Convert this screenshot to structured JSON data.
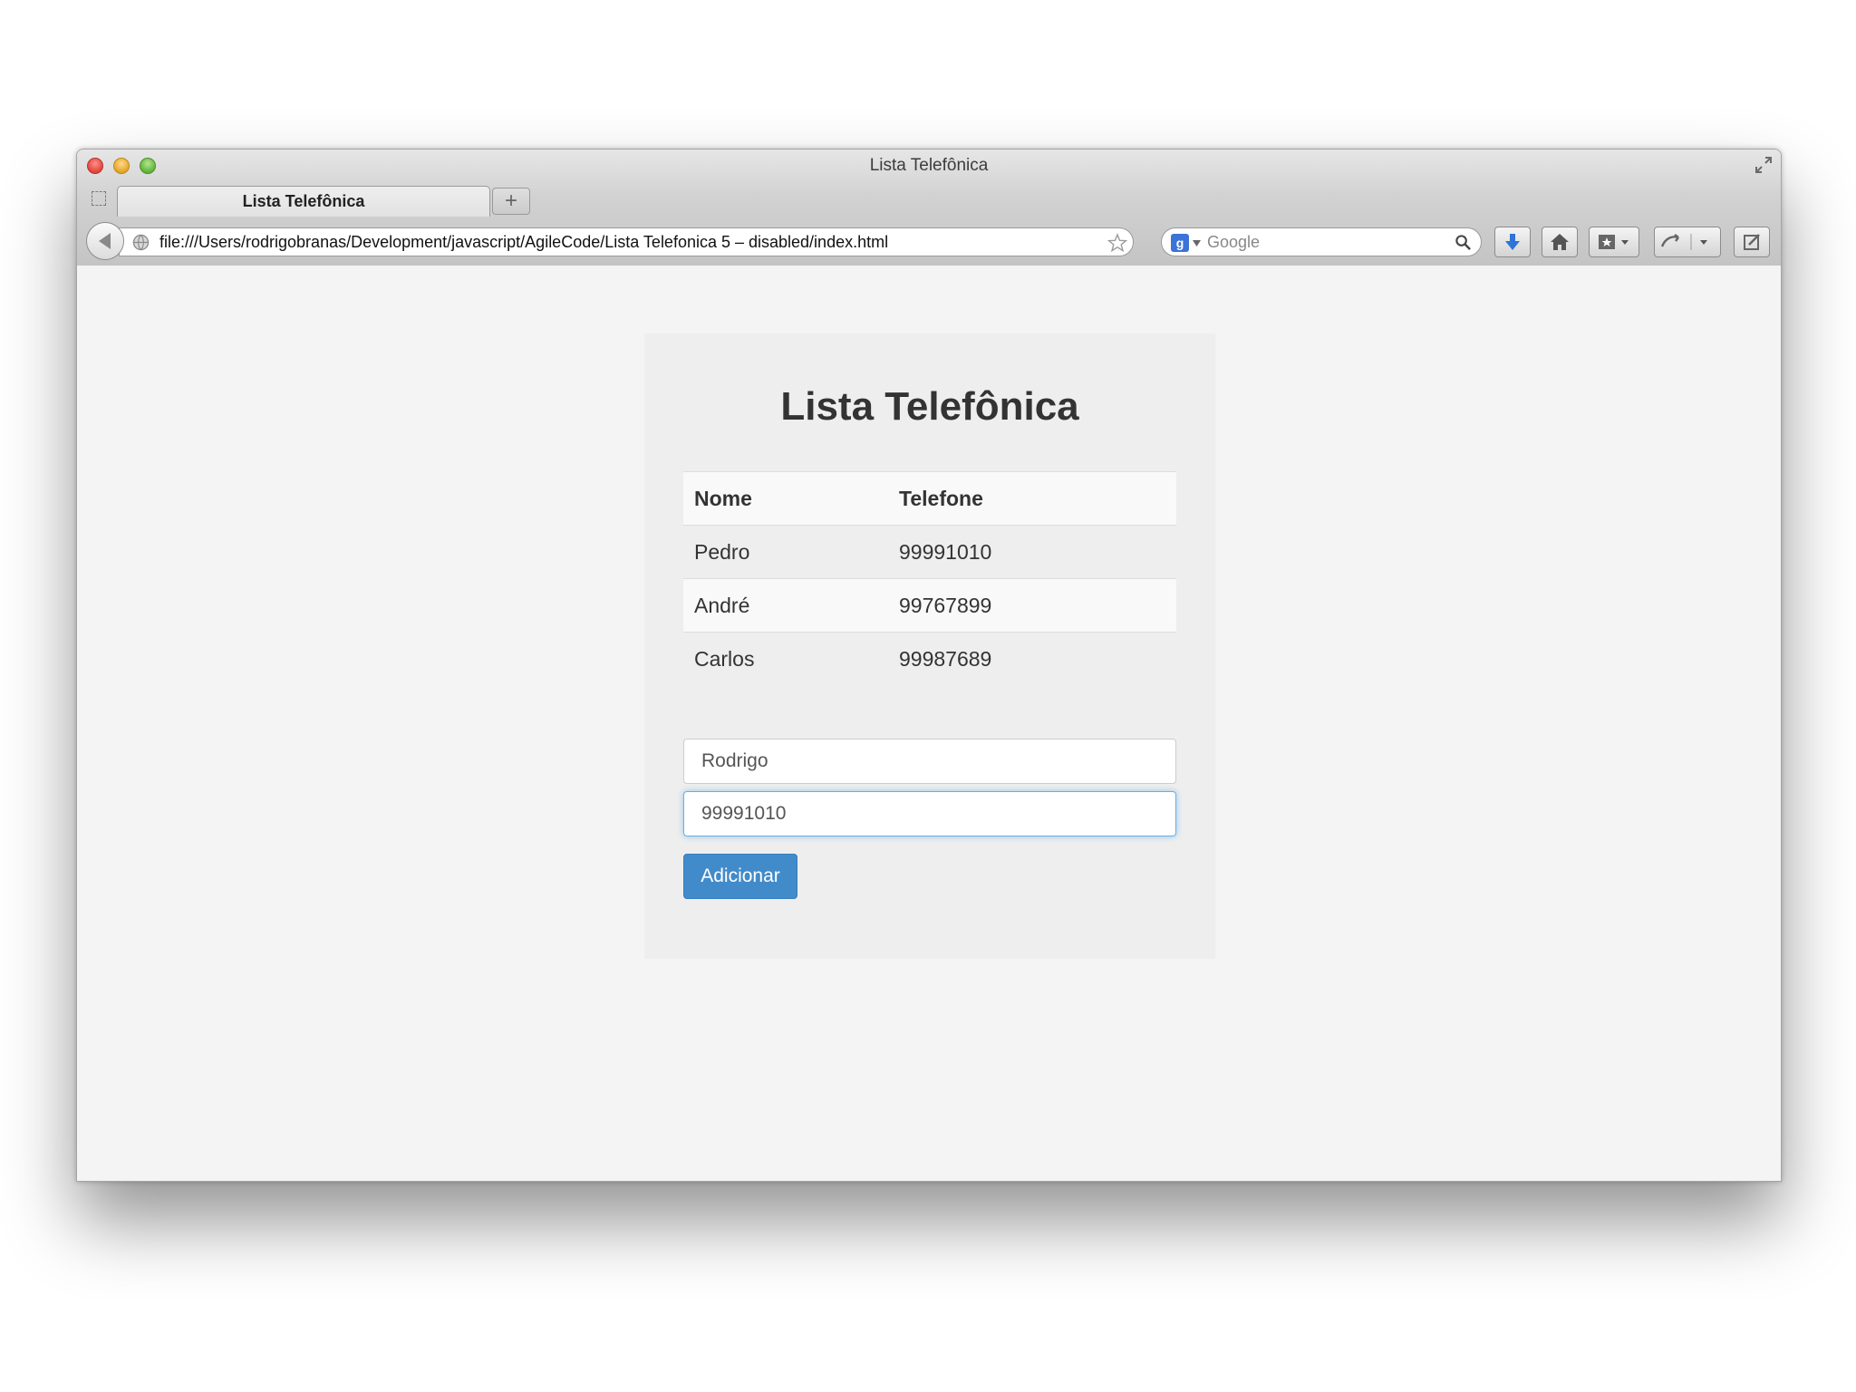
{
  "browser": {
    "window_title": "Lista Telefônica",
    "tab_label": "Lista Telefônica",
    "new_tab_label": "+",
    "url": "file:///Users/rodrigobranas/Development/javascript/AgileCode/Lista Telefonica 5 – disabled/index.html",
    "search_placeholder": "Google",
    "search_engine_letter": "g"
  },
  "page": {
    "title": "Lista Telefônica",
    "table": {
      "headers": [
        "Nome",
        "Telefone"
      ],
      "rows": [
        {
          "nome": "Pedro",
          "telefone": "99991010"
        },
        {
          "nome": "André",
          "telefone": "99767899"
        },
        {
          "nome": "Carlos",
          "telefone": "99987689"
        }
      ]
    },
    "form": {
      "name_value": "Rodrigo",
      "phone_value": "99991010",
      "add_button_label": "Adicionar"
    }
  },
  "colors": {
    "primary_button": "#428bca",
    "focus_border": "#66afe9"
  }
}
